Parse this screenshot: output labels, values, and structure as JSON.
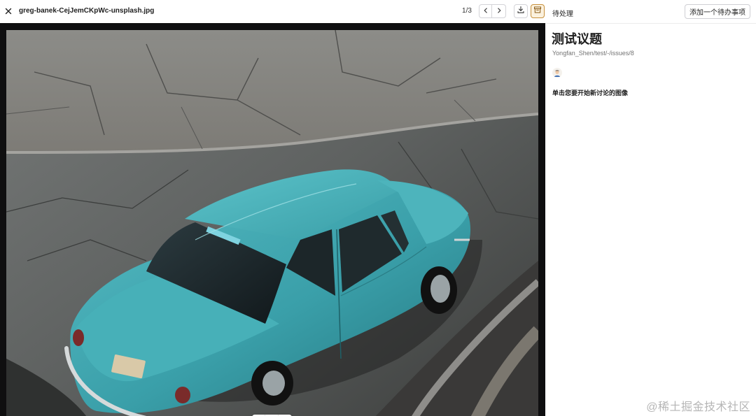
{
  "viewer": {
    "file_name": "greg-banek-CejJemCKpWc-unsplash.jpg",
    "pager": "1/3",
    "zoom": {
      "out_icon": "minus-icon",
      "reset_icon": "rotate-reset-icon",
      "in_icon": "plus-icon"
    },
    "icons": {
      "close": "close-icon",
      "prev": "chevron-left-icon",
      "next": "chevron-right-icon",
      "download": "download-icon",
      "archive": "archive-icon"
    },
    "colors": {
      "background": "#0f0f10",
      "archive_accent": "#c7903a",
      "car": "#3fa3ad"
    }
  },
  "panel": {
    "status_label": "待处理",
    "add_todo_label": "添加一个待办事项",
    "issue_title": "测试议题",
    "issue_ref": "Yongfan_Shen/test/-/issues/8",
    "avatar_icon": "user-avatar",
    "hint": "单击您要开始新讨论的图像"
  },
  "watermark": "@稀土掘金技术社区"
}
